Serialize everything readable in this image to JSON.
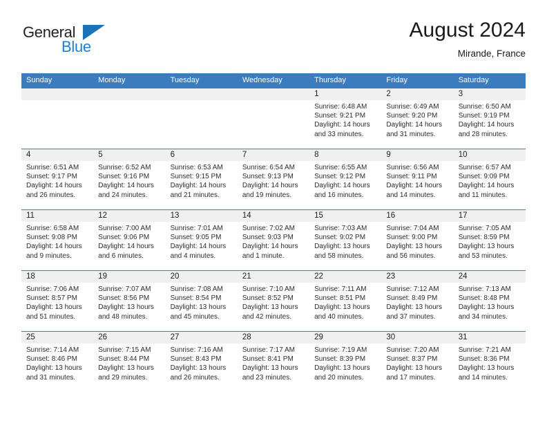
{
  "brand": {
    "name_part1": "General",
    "name_part2": "Blue",
    "triangle_icon": "triangle-logo-icon",
    "color_dark": "#231f20",
    "color_blue": "#1b7fd4"
  },
  "header": {
    "title": "August 2024",
    "location": "Mirande, France"
  },
  "theme": {
    "header_bar": "#3a7cbe",
    "daynum_band": "#f0f0f0",
    "text": "#2b2b2b"
  },
  "weekdays": [
    "Sunday",
    "Monday",
    "Tuesday",
    "Wednesday",
    "Thursday",
    "Friday",
    "Saturday"
  ],
  "labels": {
    "sunrise": "Sunrise:",
    "sunset": "Sunset:",
    "daylight": "Daylight:"
  },
  "weeks": [
    [
      {
        "day": "",
        "sunrise": "",
        "sunset": "",
        "daylight": "",
        "empty": true
      },
      {
        "day": "",
        "sunrise": "",
        "sunset": "",
        "daylight": "",
        "empty": true
      },
      {
        "day": "",
        "sunrise": "",
        "sunset": "",
        "daylight": "",
        "empty": true
      },
      {
        "day": "",
        "sunrise": "",
        "sunset": "",
        "daylight": "",
        "empty": true
      },
      {
        "day": "1",
        "sunrise": "Sunrise: 6:48 AM",
        "sunset": "Sunset: 9:21 PM",
        "daylight": "Daylight: 14 hours and 33 minutes."
      },
      {
        "day": "2",
        "sunrise": "Sunrise: 6:49 AM",
        "sunset": "Sunset: 9:20 PM",
        "daylight": "Daylight: 14 hours and 31 minutes."
      },
      {
        "day": "3",
        "sunrise": "Sunrise: 6:50 AM",
        "sunset": "Sunset: 9:19 PM",
        "daylight": "Daylight: 14 hours and 28 minutes."
      }
    ],
    [
      {
        "day": "4",
        "sunrise": "Sunrise: 6:51 AM",
        "sunset": "Sunset: 9:17 PM",
        "daylight": "Daylight: 14 hours and 26 minutes."
      },
      {
        "day": "5",
        "sunrise": "Sunrise: 6:52 AM",
        "sunset": "Sunset: 9:16 PM",
        "daylight": "Daylight: 14 hours and 24 minutes."
      },
      {
        "day": "6",
        "sunrise": "Sunrise: 6:53 AM",
        "sunset": "Sunset: 9:15 PM",
        "daylight": "Daylight: 14 hours and 21 minutes."
      },
      {
        "day": "7",
        "sunrise": "Sunrise: 6:54 AM",
        "sunset": "Sunset: 9:13 PM",
        "daylight": "Daylight: 14 hours and 19 minutes."
      },
      {
        "day": "8",
        "sunrise": "Sunrise: 6:55 AM",
        "sunset": "Sunset: 9:12 PM",
        "daylight": "Daylight: 14 hours and 16 minutes."
      },
      {
        "day": "9",
        "sunrise": "Sunrise: 6:56 AM",
        "sunset": "Sunset: 9:11 PM",
        "daylight": "Daylight: 14 hours and 14 minutes."
      },
      {
        "day": "10",
        "sunrise": "Sunrise: 6:57 AM",
        "sunset": "Sunset: 9:09 PM",
        "daylight": "Daylight: 14 hours and 11 minutes."
      }
    ],
    [
      {
        "day": "11",
        "sunrise": "Sunrise: 6:58 AM",
        "sunset": "Sunset: 9:08 PM",
        "daylight": "Daylight: 14 hours and 9 minutes."
      },
      {
        "day": "12",
        "sunrise": "Sunrise: 7:00 AM",
        "sunset": "Sunset: 9:06 PM",
        "daylight": "Daylight: 14 hours and 6 minutes."
      },
      {
        "day": "13",
        "sunrise": "Sunrise: 7:01 AM",
        "sunset": "Sunset: 9:05 PM",
        "daylight": "Daylight: 14 hours and 4 minutes."
      },
      {
        "day": "14",
        "sunrise": "Sunrise: 7:02 AM",
        "sunset": "Sunset: 9:03 PM",
        "daylight": "Daylight: 14 hours and 1 minute."
      },
      {
        "day": "15",
        "sunrise": "Sunrise: 7:03 AM",
        "sunset": "Sunset: 9:02 PM",
        "daylight": "Daylight: 13 hours and 58 minutes."
      },
      {
        "day": "16",
        "sunrise": "Sunrise: 7:04 AM",
        "sunset": "Sunset: 9:00 PM",
        "daylight": "Daylight: 13 hours and 56 minutes."
      },
      {
        "day": "17",
        "sunrise": "Sunrise: 7:05 AM",
        "sunset": "Sunset: 8:59 PM",
        "daylight": "Daylight: 13 hours and 53 minutes."
      }
    ],
    [
      {
        "day": "18",
        "sunrise": "Sunrise: 7:06 AM",
        "sunset": "Sunset: 8:57 PM",
        "daylight": "Daylight: 13 hours and 51 minutes."
      },
      {
        "day": "19",
        "sunrise": "Sunrise: 7:07 AM",
        "sunset": "Sunset: 8:56 PM",
        "daylight": "Daylight: 13 hours and 48 minutes."
      },
      {
        "day": "20",
        "sunrise": "Sunrise: 7:08 AM",
        "sunset": "Sunset: 8:54 PM",
        "daylight": "Daylight: 13 hours and 45 minutes."
      },
      {
        "day": "21",
        "sunrise": "Sunrise: 7:10 AM",
        "sunset": "Sunset: 8:52 PM",
        "daylight": "Daylight: 13 hours and 42 minutes."
      },
      {
        "day": "22",
        "sunrise": "Sunrise: 7:11 AM",
        "sunset": "Sunset: 8:51 PM",
        "daylight": "Daylight: 13 hours and 40 minutes."
      },
      {
        "day": "23",
        "sunrise": "Sunrise: 7:12 AM",
        "sunset": "Sunset: 8:49 PM",
        "daylight": "Daylight: 13 hours and 37 minutes."
      },
      {
        "day": "24",
        "sunrise": "Sunrise: 7:13 AM",
        "sunset": "Sunset: 8:48 PM",
        "daylight": "Daylight: 13 hours and 34 minutes."
      }
    ],
    [
      {
        "day": "25",
        "sunrise": "Sunrise: 7:14 AM",
        "sunset": "Sunset: 8:46 PM",
        "daylight": "Daylight: 13 hours and 31 minutes."
      },
      {
        "day": "26",
        "sunrise": "Sunrise: 7:15 AM",
        "sunset": "Sunset: 8:44 PM",
        "daylight": "Daylight: 13 hours and 29 minutes."
      },
      {
        "day": "27",
        "sunrise": "Sunrise: 7:16 AM",
        "sunset": "Sunset: 8:43 PM",
        "daylight": "Daylight: 13 hours and 26 minutes."
      },
      {
        "day": "28",
        "sunrise": "Sunrise: 7:17 AM",
        "sunset": "Sunset: 8:41 PM",
        "daylight": "Daylight: 13 hours and 23 minutes."
      },
      {
        "day": "29",
        "sunrise": "Sunrise: 7:19 AM",
        "sunset": "Sunset: 8:39 PM",
        "daylight": "Daylight: 13 hours and 20 minutes."
      },
      {
        "day": "30",
        "sunrise": "Sunrise: 7:20 AM",
        "sunset": "Sunset: 8:37 PM",
        "daylight": "Daylight: 13 hours and 17 minutes."
      },
      {
        "day": "31",
        "sunrise": "Sunrise: 7:21 AM",
        "sunset": "Sunset: 8:36 PM",
        "daylight": "Daylight: 13 hours and 14 minutes."
      }
    ]
  ]
}
